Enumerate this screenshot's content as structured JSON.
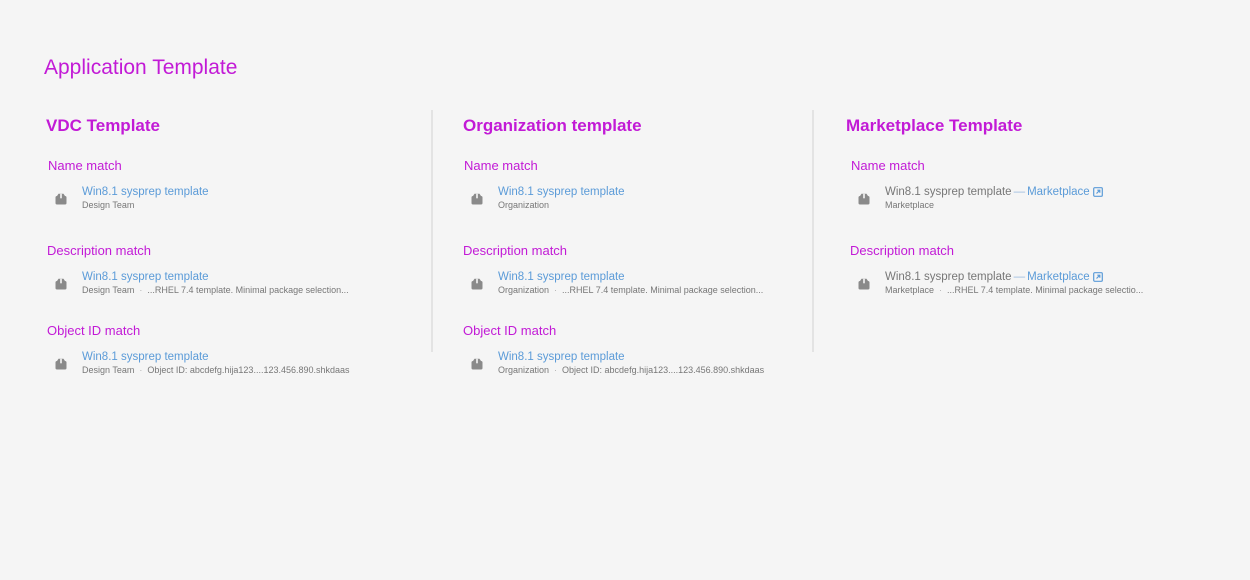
{
  "page_title": "Application Template",
  "columns": [
    {
      "title": "VDC Template",
      "groups": [
        {
          "heading": "Name match",
          "item": {
            "name": "Win8.1 sysprep template",
            "source": "Design Team",
            "detail": ""
          }
        },
        {
          "heading": "Description match",
          "item": {
            "name": "Win8.1 sysprep template",
            "source": "Design Team",
            "detail": "...RHEL 7.4 template. Minimal package selection..."
          }
        },
        {
          "heading": "Object ID match",
          "item": {
            "name": "Win8.1 sysprep template",
            "source": "Design Team",
            "detail": "Object ID: abcdefg.hija123....123.456.890.shkdaas"
          }
        }
      ]
    },
    {
      "title": "Organization template",
      "groups": [
        {
          "heading": "Name match",
          "item": {
            "name": "Win8.1 sysprep template",
            "source": "Organization",
            "detail": ""
          }
        },
        {
          "heading": "Description match",
          "item": {
            "name": "Win8.1 sysprep template",
            "source": "Organization",
            "detail": "...RHEL 7.4 template. Minimal package selection..."
          }
        },
        {
          "heading": "Object ID match",
          "item": {
            "name": "Win8.1 sysprep template",
            "source": "Organization",
            "detail": "Object ID: abcdefg.hija123....123.456.890.shkdaas"
          }
        }
      ]
    },
    {
      "title": "Marketplace Template",
      "groups": [
        {
          "heading": "Name match",
          "item": {
            "name": "Win8.1 sysprep template",
            "dash": "—",
            "link": "Marketplace",
            "source": "Marketplace",
            "detail": ""
          }
        },
        {
          "heading": "Description match",
          "item": {
            "name": "Win8.1 sysprep template",
            "dash": "—",
            "link": "Marketplace",
            "source": "Marketplace",
            "detail": "...RHEL 7.4 template. Minimal package selectio..."
          }
        }
      ]
    }
  ],
  "separator": "·",
  "icons": {
    "template": "package-icon",
    "external": "external-link-icon"
  },
  "colors": {
    "accent": "#c21ad6",
    "link": "#5b9bd8",
    "muted": "#777777",
    "background": "#f5f5f5"
  }
}
